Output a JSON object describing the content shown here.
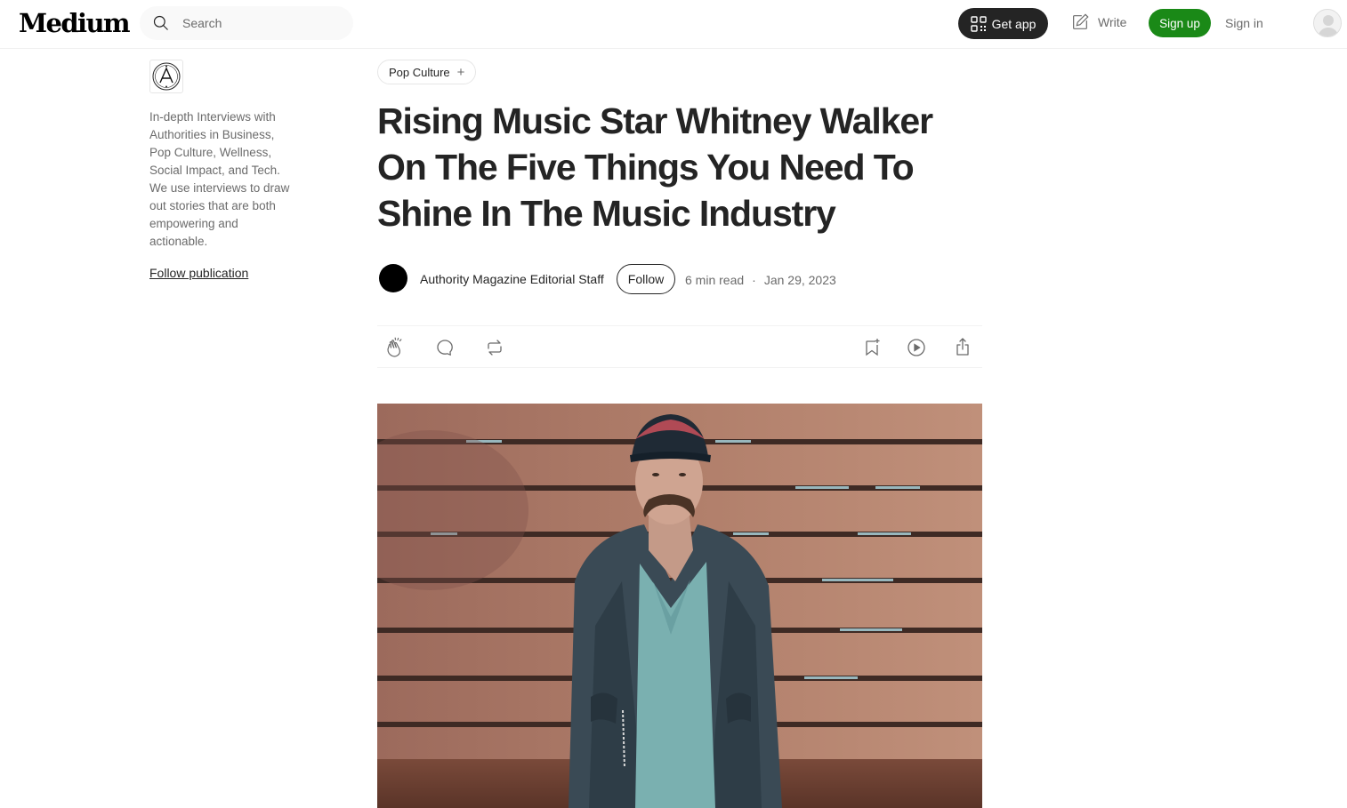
{
  "header": {
    "logo": "Medium",
    "search_placeholder": "Search",
    "get_app_label": "Get app",
    "write_label": "Write",
    "signup_label": "Sign up",
    "signin_label": "Sign in"
  },
  "sidebar": {
    "publication_description": "In-depth Interviews with Authorities in Business, Pop Culture, Wellness, Social Impact, and Tech. We use interviews to draw out stories that are both empowering and actionable.",
    "follow_publication_label": "Follow publication"
  },
  "article": {
    "tag": "Pop Culture",
    "title": "Rising Music Star Whitney Walker On The Five Things You Need To Shine In The Music Industry",
    "author": "Authority Magazine Editorial Staff",
    "follow_label": "Follow",
    "read_time": "6 min read",
    "separator": "·",
    "date": "Jan 29, 2023"
  },
  "colors": {
    "accent_green": "#1a8917",
    "text_primary": "#242424",
    "text_secondary": "#6b6b6b"
  },
  "icons": [
    "search-icon",
    "qr-code-icon",
    "write-icon",
    "user-avatar-icon",
    "clap-icon",
    "comment-icon",
    "repost-icon",
    "bookmark-icon",
    "listen-icon",
    "share-icon"
  ]
}
